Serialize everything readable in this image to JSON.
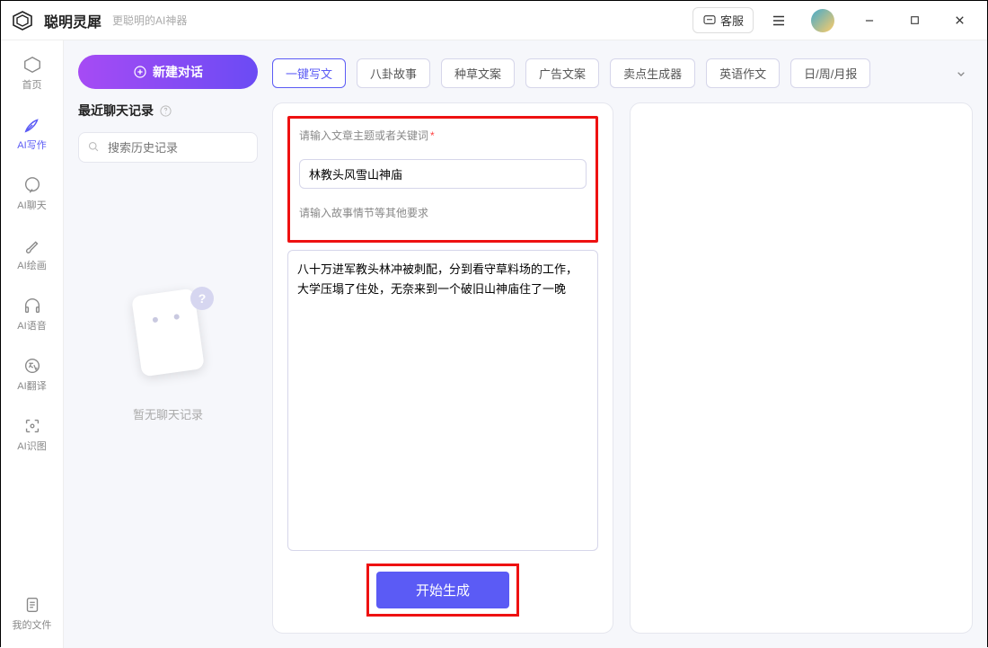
{
  "titlebar": {
    "app_name": "聪明灵犀",
    "app_tagline": "更聪明的AI神器",
    "support_label": "客服"
  },
  "rail": {
    "items": [
      {
        "label": "首页"
      },
      {
        "label": "AI写作"
      },
      {
        "label": "AI聊天"
      },
      {
        "label": "AI绘画"
      },
      {
        "label": "AI语音"
      },
      {
        "label": "AI翻译"
      },
      {
        "label": "AI识图"
      }
    ],
    "bottom_item": {
      "label": "我的文件"
    }
  },
  "leftpanel": {
    "new_chat_label": "新建对话",
    "recent_title": "最近聊天记录",
    "search_placeholder": "搜索历史记录",
    "empty_text": "暂无聊天记录"
  },
  "chips": [
    "一键写文",
    "八卦故事",
    "种草文案",
    "广告文案",
    "卖点生成器",
    "英语作文",
    "日/周/月报"
  ],
  "form": {
    "topic_label": "请输入文章主题或者关键词",
    "topic_value": "林教头风雪山神庙",
    "detail_label": "请输入故事情节等其他要求",
    "detail_value": "八十万进军教头林冲被刺配，分到看守草料场的工作，大学压塌了住处，无奈来到一个破旧山神庙住了一晚",
    "submit_label": "开始生成"
  }
}
